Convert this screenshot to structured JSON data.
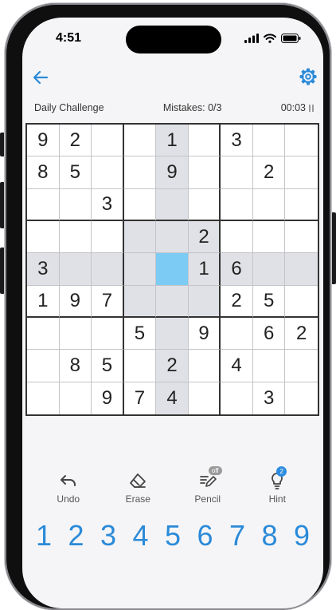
{
  "status": {
    "time": "4:51"
  },
  "header": {
    "title": "Daily Challenge",
    "mistakes": "Mistakes: 0/3",
    "timer": "00:03"
  },
  "board": {
    "cells": [
      [
        "9",
        "2",
        "",
        "",
        "1",
        "",
        "3",
        "",
        ""
      ],
      [
        "8",
        "5",
        "",
        "",
        "9",
        "",
        "",
        "2",
        ""
      ],
      [
        "",
        "",
        "3",
        "",
        "",
        "",
        "",
        "",
        ""
      ],
      [
        "",
        "",
        "",
        "",
        "",
        "2",
        "",
        "",
        ""
      ],
      [
        "3",
        "",
        "",
        "",
        "",
        "1",
        "6",
        "",
        ""
      ],
      [
        "1",
        "9",
        "7",
        "",
        "",
        "",
        "2",
        "5",
        ""
      ],
      [
        "",
        "",
        "",
        "5",
        "",
        "9",
        "",
        "6",
        "2"
      ],
      [
        "",
        "8",
        "5",
        "",
        "2",
        "",
        "4",
        "",
        ""
      ],
      [
        "",
        "",
        "9",
        "7",
        "4",
        "",
        "",
        "3",
        ""
      ]
    ],
    "selected": [
      4,
      4
    ]
  },
  "tools": [
    {
      "label": "Undo",
      "icon": "undo-icon"
    },
    {
      "label": "Erase",
      "icon": "eraser-icon"
    },
    {
      "label": "Pencil",
      "icon": "pencil-icon",
      "badge": "off"
    },
    {
      "label": "Hint",
      "icon": "lightbulb-icon",
      "badge": "2"
    }
  ],
  "numpad": [
    "1",
    "2",
    "3",
    "4",
    "5",
    "6",
    "7",
    "8",
    "9"
  ],
  "colors": {
    "accent": "#2b8ad8",
    "selected": "#7ccbf5",
    "highlight": "#dfe1e6"
  }
}
